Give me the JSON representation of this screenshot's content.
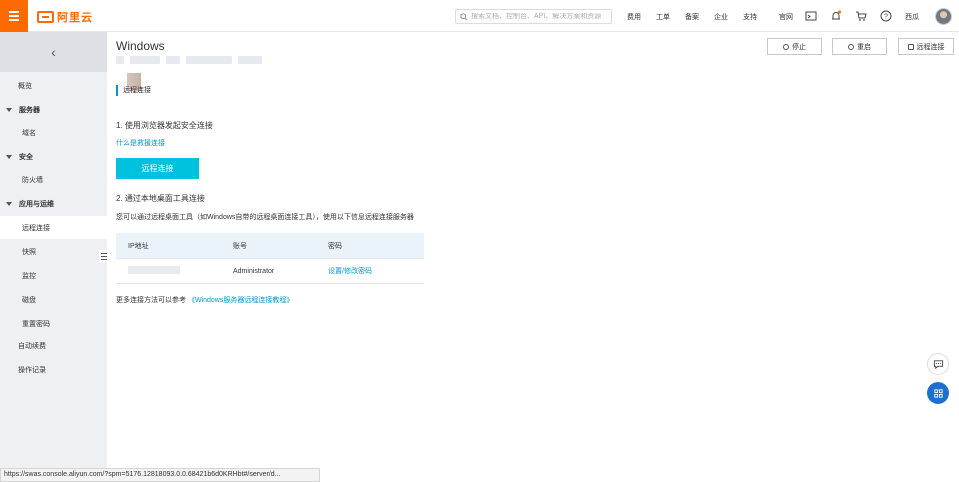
{
  "topbar": {
    "brand": "阿里云",
    "search_placeholder": "搜索文档、控制台、API、解决方案和资源",
    "nav": [
      "费用",
      "工单",
      "备案",
      "企业",
      "支持",
      "官网"
    ],
    "user_name": "西瓜",
    "icons": [
      "menu-icon",
      "search-icon",
      "terminal-icon",
      "bell-icon",
      "cart-icon",
      "help-icon"
    ],
    "accent_color": "#ff6a00"
  },
  "sidebar": {
    "items": [
      {
        "label": "概览",
        "type": "top"
      },
      {
        "label": "服务器",
        "type": "group"
      },
      {
        "label": "域名",
        "type": "child"
      },
      {
        "label": "安全",
        "type": "group"
      },
      {
        "label": "防火墙",
        "type": "child"
      },
      {
        "label": "应用与运维",
        "type": "group"
      },
      {
        "label": "远程连接",
        "type": "child",
        "active": true
      },
      {
        "label": "快照",
        "type": "child"
      },
      {
        "label": "监控",
        "type": "child"
      },
      {
        "label": "磁盘",
        "type": "child"
      },
      {
        "label": "重置密码",
        "type": "child"
      },
      {
        "label": "自动续费",
        "type": "top"
      },
      {
        "label": "操作记录",
        "type": "top"
      }
    ]
  },
  "main": {
    "title": "Windows",
    "section_label": "远程连接",
    "step1": "1. 使用浏览器发起安全连接",
    "step1_link": "什么是救援连接",
    "remote_button": "远程连接",
    "step2": "2. 通过本地桌面工具连接",
    "step2_desc": "您可以通过远程桌面工具（如Windows自带的远程桌面连接工具），使用以下信息远程连接服务器",
    "table": {
      "headers": [
        "IP地址",
        "账号",
        "密码"
      ],
      "rows": [
        {
          "ip": "",
          "account": "Administrator",
          "password_action": "设置/修改密码"
        }
      ]
    },
    "footnote_prefix": "更多连接方法可以参考",
    "footnote_link": "《Windows服务器远程连接教程》",
    "header_buttons": [
      "停止",
      "重启",
      "远程连接"
    ]
  },
  "statusbar": "https://swas.console.aliyun.com/?spm=5176.12818093.0.0.68421b6d0KRHbt#/server/d..."
}
